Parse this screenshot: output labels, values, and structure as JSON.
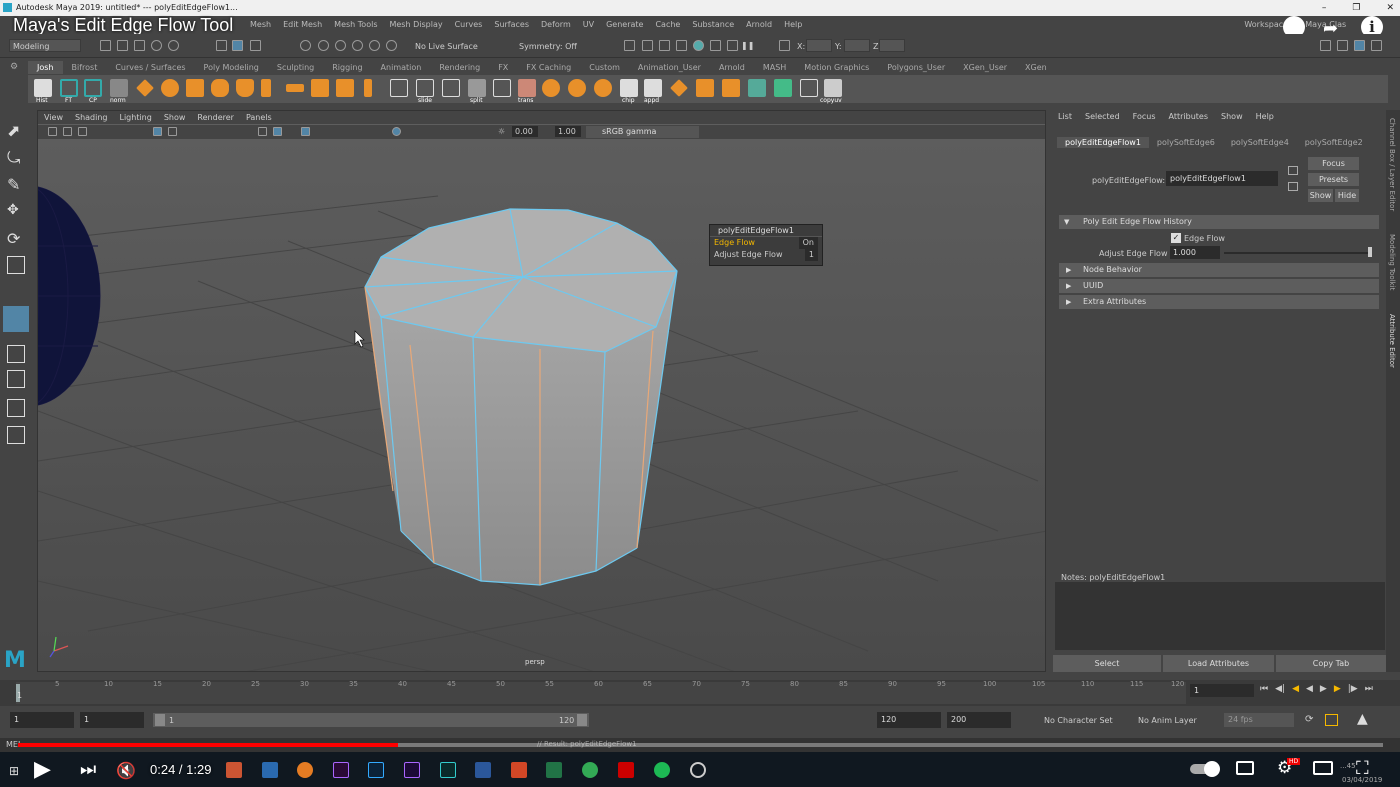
{
  "window": {
    "title": "Autodesk Maya 2019: untitled*   ---   polyEditEdgeFlow1..."
  },
  "video": {
    "title": "Maya's Edit Edge Flow Tool",
    "time": "0:24 / 1:29"
  },
  "menubar": {
    "items": [
      "File",
      "Edit",
      "Create",
      "Select",
      "Modify",
      "Display",
      "Windows",
      "Mesh",
      "Edit Mesh",
      "Mesh Tools",
      "Mesh Display",
      "Curves",
      "Surfaces",
      "Deform",
      "UV",
      "Generate",
      "Cache",
      "Substance",
      "Arnold",
      "Help"
    ],
    "workspace_label": "Workspace :",
    "workspace_value": "Maya Clas"
  },
  "toolbar": {
    "mode": "Modeling",
    "live_surface": "No Live Surface",
    "symmetry": "Symmetry: Off",
    "x_label": "X:",
    "y_label": "Y:",
    "z_label": "Z:"
  },
  "shelf": {
    "tabs": [
      "Josh",
      "Bifrost",
      "Curves / Surfaces",
      "Poly Modeling",
      "Sculpting",
      "Rigging",
      "Animation",
      "Rendering",
      "FX",
      "FX Caching",
      "Custom",
      "Animation_User",
      "Arnold",
      "MASH",
      "Motion Graphics",
      "Polygons_User",
      "XGen_User",
      "XGen"
    ],
    "labels": {
      "hist": "Hist",
      "ft": "FT",
      "cp": "CP",
      "norm": "norm",
      "slide": "slide",
      "split": "split",
      "trans": "trans",
      "chip": "chip",
      "appd": "appd",
      "copyuv": "copyuv"
    }
  },
  "viewport": {
    "menus": [
      "View",
      "Shading",
      "Lighting",
      "Show",
      "Renderer",
      "Panels"
    ],
    "exposure": "0.00",
    "gamma": "1.00",
    "colorspace": "sRGB gamma",
    "camera": "persp"
  },
  "popup": {
    "title": "polyEditEdgeFlow1",
    "row1_label": "Edge Flow",
    "row1_value": "On",
    "row2_label": "Adjust Edge Flow",
    "row2_value": "1"
  },
  "attr": {
    "menus": [
      "List",
      "Selected",
      "Focus",
      "Attributes",
      "Show",
      "Help"
    ],
    "tabs": [
      "polyEditEdgeFlow1",
      "polySoftEdge6",
      "polySoftEdge4",
      "polySoftEdge2"
    ],
    "node_label": "polyEditEdgeFlow:",
    "node_value": "polyEditEdgeFlow1",
    "focus": "Focus",
    "presets": "Presets",
    "show": "Show",
    "hide": "Hide",
    "section_history": "Poly Edit Edge Flow History",
    "edge_flow_label": "Edge Flow",
    "adjust_label": "Adjust Edge Flow",
    "adjust_value": "1.000",
    "sections": [
      "Node Behavior",
      "UUID",
      "Extra Attributes"
    ],
    "notes": "Notes:  polyEditEdgeFlow1",
    "buttons": [
      "Select",
      "Load Attributes",
      "Copy Tab"
    ]
  },
  "side_tabs": [
    "Channel Box / Layer Editor",
    "Modeling Toolkit",
    "Attribute Editor"
  ],
  "timeline": {
    "ticks": [
      "1",
      "5",
      "10",
      "15",
      "20",
      "25",
      "30",
      "35",
      "40",
      "45",
      "50",
      "55",
      "60",
      "65",
      "70",
      "75",
      "80",
      "85",
      "90",
      "95",
      "100",
      "105",
      "110",
      "115",
      "120"
    ],
    "current": "1"
  },
  "range": {
    "start": "1",
    "start2": "1",
    "slider_start": "1",
    "slider_end": "120",
    "end": "120",
    "end2": "200",
    "character": "No Character Set",
    "anim_layer": "No Anim Layer",
    "fps": "24 fps"
  },
  "cmdline": {
    "result": "// Result: polyEditEdgeFlow1"
  },
  "taskbar": {
    "clock": "03/04/2019",
    "clock_time": "...45"
  }
}
